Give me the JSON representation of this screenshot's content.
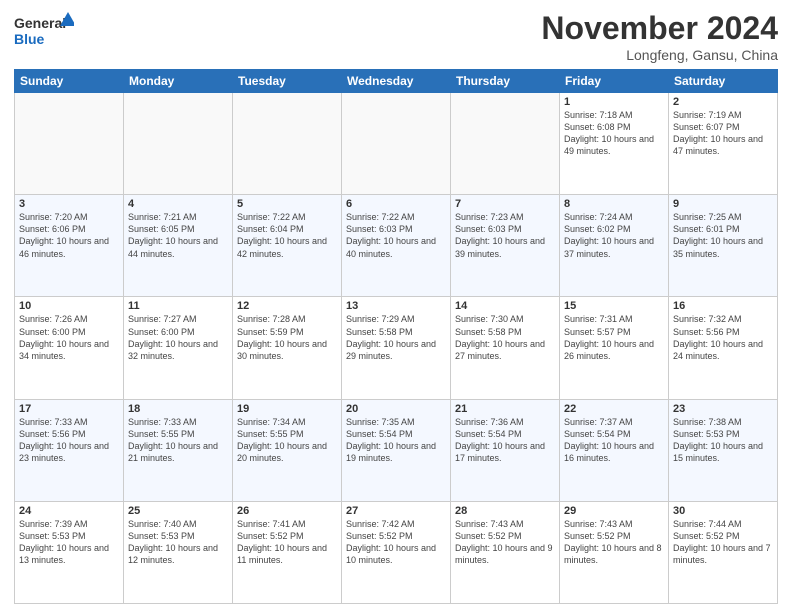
{
  "header": {
    "logo_general": "General",
    "logo_blue": "Blue",
    "month_title": "November 2024",
    "location": "Longfeng, Gansu, China"
  },
  "days_of_week": [
    "Sunday",
    "Monday",
    "Tuesday",
    "Wednesday",
    "Thursday",
    "Friday",
    "Saturday"
  ],
  "weeks": [
    [
      {
        "date": "",
        "info": ""
      },
      {
        "date": "",
        "info": ""
      },
      {
        "date": "",
        "info": ""
      },
      {
        "date": "",
        "info": ""
      },
      {
        "date": "",
        "info": ""
      },
      {
        "date": "1",
        "info": "Sunrise: 7:18 AM\nSunset: 6:08 PM\nDaylight: 10 hours and 49 minutes."
      },
      {
        "date": "2",
        "info": "Sunrise: 7:19 AM\nSunset: 6:07 PM\nDaylight: 10 hours and 47 minutes."
      }
    ],
    [
      {
        "date": "3",
        "info": "Sunrise: 7:20 AM\nSunset: 6:06 PM\nDaylight: 10 hours and 46 minutes."
      },
      {
        "date": "4",
        "info": "Sunrise: 7:21 AM\nSunset: 6:05 PM\nDaylight: 10 hours and 44 minutes."
      },
      {
        "date": "5",
        "info": "Sunrise: 7:22 AM\nSunset: 6:04 PM\nDaylight: 10 hours and 42 minutes."
      },
      {
        "date": "6",
        "info": "Sunrise: 7:22 AM\nSunset: 6:03 PM\nDaylight: 10 hours and 40 minutes."
      },
      {
        "date": "7",
        "info": "Sunrise: 7:23 AM\nSunset: 6:03 PM\nDaylight: 10 hours and 39 minutes."
      },
      {
        "date": "8",
        "info": "Sunrise: 7:24 AM\nSunset: 6:02 PM\nDaylight: 10 hours and 37 minutes."
      },
      {
        "date": "9",
        "info": "Sunrise: 7:25 AM\nSunset: 6:01 PM\nDaylight: 10 hours and 35 minutes."
      }
    ],
    [
      {
        "date": "10",
        "info": "Sunrise: 7:26 AM\nSunset: 6:00 PM\nDaylight: 10 hours and 34 minutes."
      },
      {
        "date": "11",
        "info": "Sunrise: 7:27 AM\nSunset: 6:00 PM\nDaylight: 10 hours and 32 minutes."
      },
      {
        "date": "12",
        "info": "Sunrise: 7:28 AM\nSunset: 5:59 PM\nDaylight: 10 hours and 30 minutes."
      },
      {
        "date": "13",
        "info": "Sunrise: 7:29 AM\nSunset: 5:58 PM\nDaylight: 10 hours and 29 minutes."
      },
      {
        "date": "14",
        "info": "Sunrise: 7:30 AM\nSunset: 5:58 PM\nDaylight: 10 hours and 27 minutes."
      },
      {
        "date": "15",
        "info": "Sunrise: 7:31 AM\nSunset: 5:57 PM\nDaylight: 10 hours and 26 minutes."
      },
      {
        "date": "16",
        "info": "Sunrise: 7:32 AM\nSunset: 5:56 PM\nDaylight: 10 hours and 24 minutes."
      }
    ],
    [
      {
        "date": "17",
        "info": "Sunrise: 7:33 AM\nSunset: 5:56 PM\nDaylight: 10 hours and 23 minutes."
      },
      {
        "date": "18",
        "info": "Sunrise: 7:33 AM\nSunset: 5:55 PM\nDaylight: 10 hours and 21 minutes."
      },
      {
        "date": "19",
        "info": "Sunrise: 7:34 AM\nSunset: 5:55 PM\nDaylight: 10 hours and 20 minutes."
      },
      {
        "date": "20",
        "info": "Sunrise: 7:35 AM\nSunset: 5:54 PM\nDaylight: 10 hours and 19 minutes."
      },
      {
        "date": "21",
        "info": "Sunrise: 7:36 AM\nSunset: 5:54 PM\nDaylight: 10 hours and 17 minutes."
      },
      {
        "date": "22",
        "info": "Sunrise: 7:37 AM\nSunset: 5:54 PM\nDaylight: 10 hours and 16 minutes."
      },
      {
        "date": "23",
        "info": "Sunrise: 7:38 AM\nSunset: 5:53 PM\nDaylight: 10 hours and 15 minutes."
      }
    ],
    [
      {
        "date": "24",
        "info": "Sunrise: 7:39 AM\nSunset: 5:53 PM\nDaylight: 10 hours and 13 minutes."
      },
      {
        "date": "25",
        "info": "Sunrise: 7:40 AM\nSunset: 5:53 PM\nDaylight: 10 hours and 12 minutes."
      },
      {
        "date": "26",
        "info": "Sunrise: 7:41 AM\nSunset: 5:52 PM\nDaylight: 10 hours and 11 minutes."
      },
      {
        "date": "27",
        "info": "Sunrise: 7:42 AM\nSunset: 5:52 PM\nDaylight: 10 hours and 10 minutes."
      },
      {
        "date": "28",
        "info": "Sunrise: 7:43 AM\nSunset: 5:52 PM\nDaylight: 10 hours and 9 minutes."
      },
      {
        "date": "29",
        "info": "Sunrise: 7:43 AM\nSunset: 5:52 PM\nDaylight: 10 hours and 8 minutes."
      },
      {
        "date": "30",
        "info": "Sunrise: 7:44 AM\nSunset: 5:52 PM\nDaylight: 10 hours and 7 minutes."
      }
    ]
  ]
}
